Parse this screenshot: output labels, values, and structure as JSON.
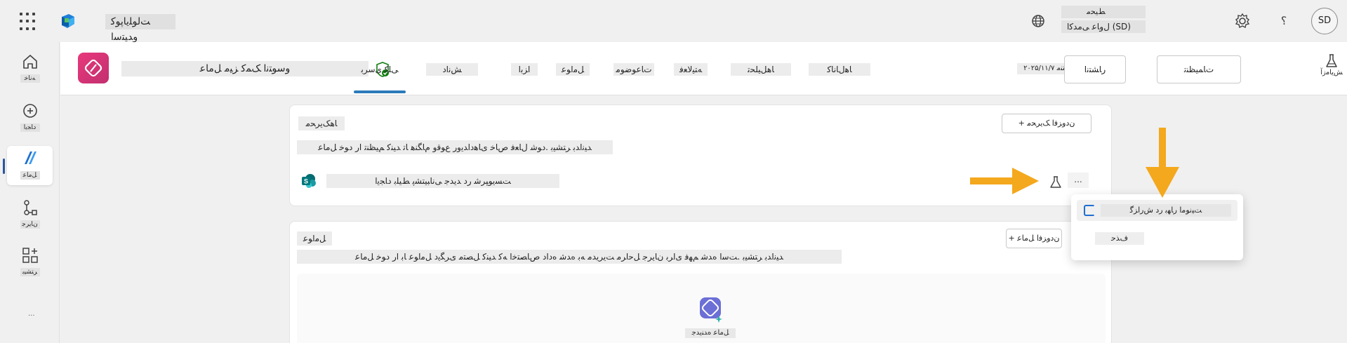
{
  "app": {
    "brand_name": "ﺖﻟﻮﻠﻳﺎﭘﻮﮐ ﻭﺪﻴﺘﺳﺍ",
    "environment_line1": "ﻂﻴﺤﻣ",
    "environment_line2": "ﻝﻭﺎﻋ ﯽﻣﺪﻛﺍ (SD)",
    "avatar_initials": "SD",
    "help_label": "؟",
    "accent_color": "#2b7bb9",
    "agent_logo_color": "#e8387c",
    "arrow_color": "#f4a81d"
  },
  "rail": {
    "items": [
      {
        "label": "ﻪﻧﺎﺧ",
        "icon": "home-icon"
      },
      {
        "label": "ﺩﺎﺠﻳﺍ",
        "icon": "create-icon"
      },
      {
        "label": "ﻞﻣﺎﻋ",
        "icon": "agents-icon"
      },
      {
        "label": "ﻥﺎﻳﺮﺟ",
        "icon": "flows-icon"
      },
      {
        "label": "ﺮﺘﺸﻴﺑ",
        "icon": "apps-icon"
      }
    ],
    "more": "..."
  },
  "agent": {
    "name": "ﻭﺳﻮﺘﻧﺍ ﮏﻤﮐ ﺰﻴﻣ ﻞﻣﺎﻋ",
    "tabs": [
      {
        "label": "ﯽﻠﮐ ﯼﺳﺮﺑ"
      },
      {
        "label": "ﺶﻧﺍﺩ"
      },
      {
        "label": "ﺍﺰﺑﺍ"
      },
      {
        "label": "ﻞﻣﺍﻮﻋ"
      },
      {
        "label": "ﺕﺎﻋﻮﺿﻮﻣ"
      },
      {
        "label": "ﻪﺘﻴﻟﺎﻌﻓ"
      },
      {
        "label": "ﺎﻫﻞﻴﻠﺤﺗ"
      },
      {
        "label": "ﺎﻫﻝﺎﻧﺎﻛ"
      }
    ],
    "published": "۲۰۲۵/۱۱/۷ ﺭﺩ ﻩﺪﺷ ﺮﺸﺘﻨﻣ",
    "buttons": {
      "publish": "ﺭﺎﺸﺘﻧﺍ",
      "settings": "ﺕﺎﻤﻴﻈﻨﺗ",
      "test": "ﺶﻳﺎﻣﺯﺁ",
      "more": "..."
    }
  },
  "knowledge_card": {
    "title": "ﺎﻫﮏﻳﺮﺤﻣ",
    "add_button": "+ ﻥﺩﻭﺰﻓﺍ ﮏﻳﺮﺤﻣ",
    "description": "ﺪﻴﻧﺍﺪﺑ ﺮﺘﺸﻴﺑ .ﺩﻮﺷ ﻝﺎﻌﻓ ﺹﺎﺧ ﯼﺎﻫﺩﺍﺪﻳﻭﺭ ﻉﻮﻗﻭ ﻡﺎﮕﻨﻫ ﺎﺗ ﺪﻴﻨﮐ ﻢﻴﻈﻨﺗ ﺍﺭ ﺩﻮﺧ ﻞﻣﺎﻋ",
    "row_label": "ﺖﺴﻳﻮﭙﺮﺷ ﺭﺩ ﺪﻳﺪﺟ ﯽﻧﺎﺒﻴﺘﺸﭘ ﻂﻴﻠﺑ ﺩﺎﺠﻳﺍ",
    "row_more": "..."
  },
  "agents_card": {
    "title": "ﻞﻣﺍﻮﻋ",
    "add_button": "+ ﻥﺩﻭﺰﻓﺍ ﻞﻣﺎﻋ",
    "description": "ﺪﻴﻧﺍﺪﺑ ﺮﺘﺸﻴﺑ .ﺖﺳﺍ ﻩﺪﺷ ﻢﻬﻓ ﯼﺍﺮﺑ ﻥﺎﻳﺮﺟ ﻞﺣﺍﺮﻣ ﺖﻳﺮﻳﺪﻣ ﻪﺑ ﻩﺪﺷ ﻩﺩﺍﺩ ﺹﺎﺼﺘﺧﺍ ﻪﮐ ﺪﻴﻨﮐ ﻞﺼﺘﻣ ﯼﺮﮕﻳﺩ ﻞﻣﺍﻮﻋ ﺎﺑ ﺍﺭ ﺩﻮﺧ ﻞﻣﺎﻋ",
    "copilot_label": "ﻞﻣﺎﻋ ﻩﺪﻨﻳﺪﺟ"
  },
  "menu": {
    "item1": "ﺖﻴﻧﻮﻣﺍ ﺭﺎﻬﺑ ﺭﺩ ﺵﺭﺍﺰﮔ",
    "item2": "ﻑﺬﺣ"
  }
}
